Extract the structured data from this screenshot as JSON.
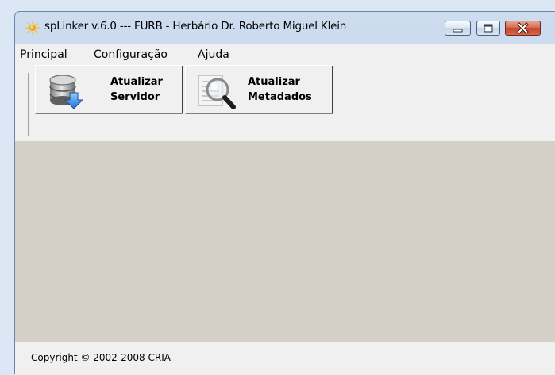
{
  "window": {
    "title": "spLinker v.6.0 --- FURB - Herbário Dr. Roberto Miguel Klein",
    "icon": "sun-icon",
    "controls": [
      "minimize-icon",
      "maximize-icon",
      "close-icon"
    ]
  },
  "menu": {
    "items": [
      {
        "label": "Principal"
      },
      {
        "label": "Configuração"
      },
      {
        "label": "Ajuda"
      }
    ]
  },
  "toolbar": {
    "buttons": [
      {
        "label": "Atualizar\nServidor",
        "icon": "database-download-icon"
      },
      {
        "label": "Atualizar\nMetadados",
        "icon": "magnifier-document-icon"
      }
    ]
  },
  "status": {
    "text": "Copyright © 2002-2008 CRIA"
  },
  "colors": {
    "titlebar": "#cddcee",
    "client_background": "#d4d0c8",
    "bars": "#f0f0f0",
    "close_button": "#c1472e"
  }
}
